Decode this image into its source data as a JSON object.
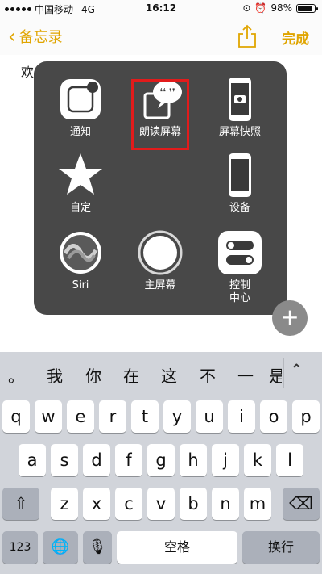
{
  "status": {
    "carrier": "中国移动",
    "network": "4G",
    "time": "16:12",
    "battery": "98%",
    "battery_level": 0.98
  },
  "nav": {
    "back_label": "备忘录",
    "done_label": "完成"
  },
  "note": {
    "text": "欢"
  },
  "assistive": {
    "items": [
      {
        "label": "通知",
        "icon": "notification-icon"
      },
      {
        "label": "朗读屏幕",
        "icon": "speak-screen-icon"
      },
      {
        "label": "屏幕快照",
        "icon": "screenshot-icon"
      },
      {
        "label": "自定",
        "icon": "star-icon"
      },
      {
        "label": "设备",
        "icon": "device-icon"
      },
      {
        "label": "Siri",
        "icon": "siri-icon"
      },
      {
        "label": "主屏幕",
        "icon": "home-button-icon"
      },
      {
        "label": "控制中心",
        "label_line1": "控制",
        "label_line2": "中心",
        "icon": "control-center-icon"
      }
    ],
    "highlight_color": "#e21b1b"
  },
  "fab": {
    "symbol": "+"
  },
  "candidates": [
    "。",
    "我",
    "你",
    "在",
    "这",
    "不",
    "一",
    "是"
  ],
  "keyboard": {
    "row1": [
      "q",
      "w",
      "e",
      "r",
      "t",
      "y",
      "u",
      "i",
      "o",
      "p"
    ],
    "row2": [
      "a",
      "s",
      "d",
      "f",
      "g",
      "h",
      "j",
      "k",
      "l"
    ],
    "row3": [
      "z",
      "x",
      "c",
      "v",
      "b",
      "n",
      "m"
    ],
    "numbers_label": "123",
    "space_label": "空格",
    "return_label": "换行"
  },
  "colors": {
    "accent": "#e0a500",
    "keyboard_bg": "#d1d4da",
    "panel_bg": "#3a3a3a"
  }
}
